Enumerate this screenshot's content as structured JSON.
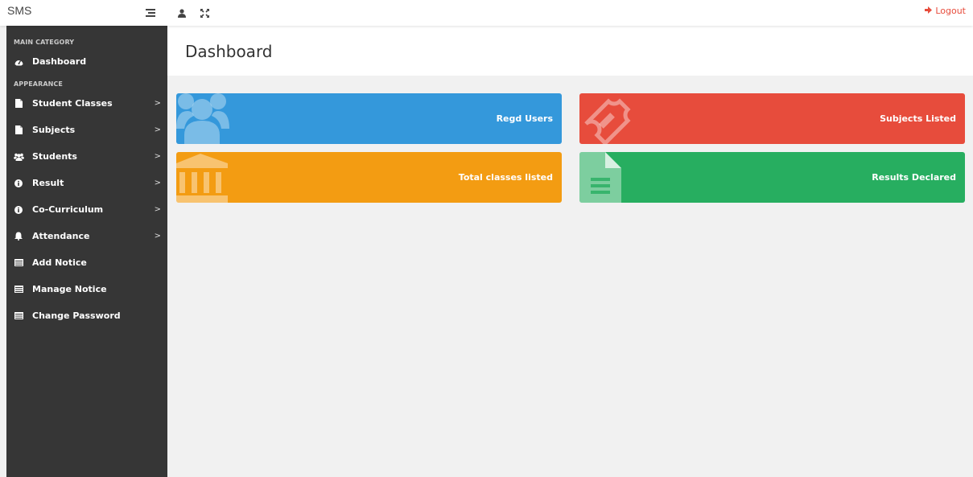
{
  "topbar": {
    "brand": "SMS",
    "icons": [
      "menu-icon",
      "user-icon",
      "fullscreen-icon"
    ],
    "logout_label": "Logout"
  },
  "sidebar": {
    "sections": [
      {
        "title": "MAIN CATEGORY"
      },
      {
        "title": "APPEARANCE"
      }
    ],
    "items": [
      {
        "label": "Dashboard",
        "icon": "dashboard-icon",
        "has_submenu": false
      },
      {
        "label": "Student Classes",
        "icon": "file-icon",
        "has_submenu": true
      },
      {
        "label": "Subjects",
        "icon": "file-icon",
        "has_submenu": true
      },
      {
        "label": "Students",
        "icon": "users-icon",
        "has_submenu": true
      },
      {
        "label": "Result",
        "icon": "info-icon",
        "has_submenu": true
      },
      {
        "label": "Co-Curriculum",
        "icon": "info-icon",
        "has_submenu": true
      },
      {
        "label": "Attendance",
        "icon": "bell-icon",
        "has_submenu": true
      },
      {
        "label": "Add Notice",
        "icon": "notice-icon",
        "has_submenu": false
      },
      {
        "label": "Manage Notice",
        "icon": "notice-icon",
        "has_submenu": false
      },
      {
        "label": "Change Password",
        "icon": "notice-icon",
        "has_submenu": false
      }
    ],
    "chevron": ">"
  },
  "main": {
    "title": "Dashboard",
    "cards": [
      {
        "label": "Regd Users",
        "color": "#3498db",
        "icon": "users-icon"
      },
      {
        "label": "Subjects Listed",
        "color": "#e74c3c",
        "icon": "ticket-icon"
      },
      {
        "label": "Total classes listed",
        "color": "#f39c12",
        "icon": "bank-icon"
      },
      {
        "label": "Results Declared",
        "color": "#27ae60",
        "icon": "document-icon"
      }
    ]
  },
  "colors": {
    "sidebar_bg": "#363636",
    "accent_logout": "#e74c3c",
    "content_bg": "#f1f1f1"
  }
}
